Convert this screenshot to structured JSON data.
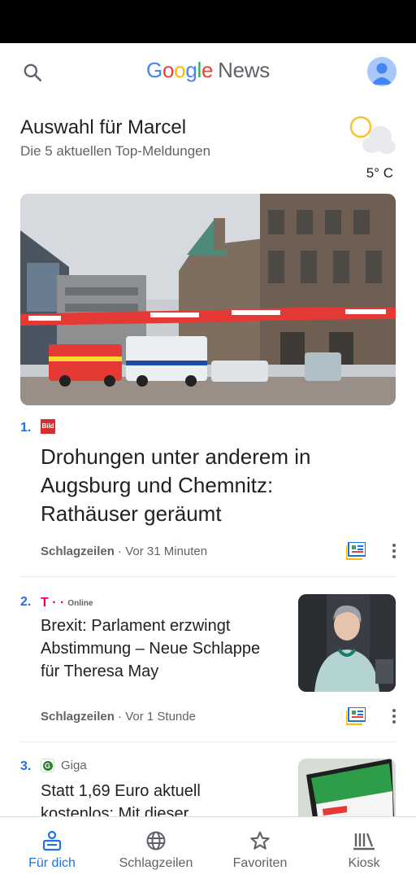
{
  "app": {
    "title_parts": [
      "G",
      "o",
      "o",
      "g",
      "l",
      "e"
    ],
    "title_suffix": "News",
    "search_icon": "search-icon",
    "avatar_icon": "account-avatar-icon"
  },
  "briefing": {
    "title": "Auswahl für Marcel",
    "subtitle": "Die 5 aktuellen Top-Meldungen"
  },
  "weather": {
    "icon": "partly-cloudy-icon",
    "temp": "5° C"
  },
  "articles": [
    {
      "rank": "1.",
      "source_logo": "bild-logo",
      "source_logo_text": "Bild",
      "headline": "Drohungen unter anderem in Augsburg und Chemnitz: Rathäuser geräumt",
      "section": "Schlagzeilen",
      "time": " · Vor 31 Minuten"
    },
    {
      "rank": "2.",
      "source_logo": "t-online-logo",
      "source_logo_text": "T · ·",
      "source_name": "Online",
      "headline": "Brexit: Parlament erzwingt Abstimmung – Neue Schlappe für Theresa May",
      "section": "Schlagzeilen",
      "time": " · Vor 1 Stunde"
    },
    {
      "rank": "3.",
      "source_logo": "giga-logo",
      "source_logo_text": "G",
      "source_name": "Giga",
      "headline": "Statt 1,69 Euro aktuell kostenlos: Mit dieser"
    }
  ],
  "bottom_nav": [
    {
      "label": "Für dich",
      "icon": "for-you-icon",
      "active": true
    },
    {
      "label": "Schlagzeilen",
      "icon": "globe-icon",
      "active": false
    },
    {
      "label": "Favoriten",
      "icon": "star-icon",
      "active": false
    },
    {
      "label": "Kiosk",
      "icon": "newsstand-icon",
      "active": false
    }
  ],
  "colors": {
    "accent": "#1a73e8",
    "google_blue": "#4285f4",
    "google_red": "#ea4335",
    "google_yellow": "#fbbc05",
    "google_green": "#34a853"
  }
}
